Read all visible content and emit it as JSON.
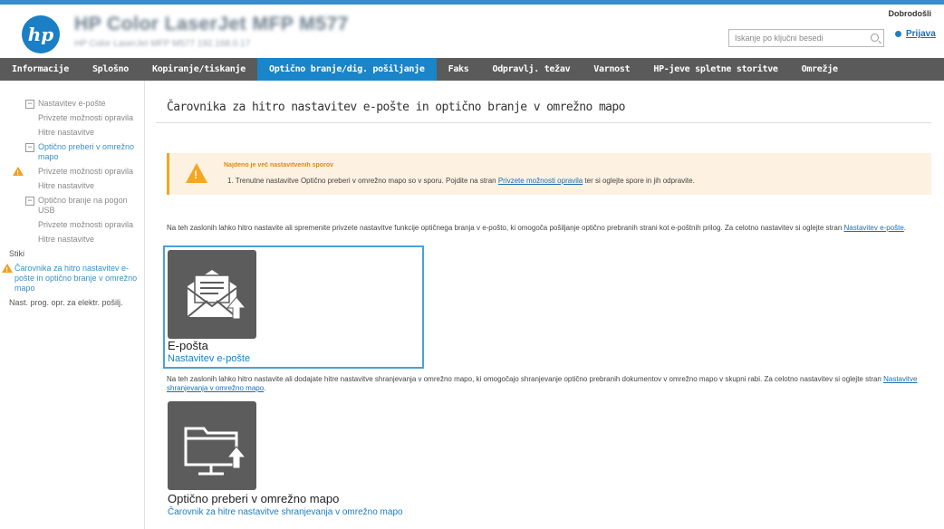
{
  "header": {
    "logo_text": "hp",
    "product_name": "HP Color LaserJet MFP M577",
    "product_sub": "HP Color LaserJet MFP M577   192.168.0.17",
    "welcome": "Dobrodošli",
    "search_placeholder": "Iskanje po ključni besedi",
    "signin": "Prijava"
  },
  "nav": {
    "tabs": [
      {
        "label": "Informacije",
        "active": false
      },
      {
        "label": "Splošno",
        "active": false
      },
      {
        "label": "Kopiranje/tiskanje",
        "active": false
      },
      {
        "label": "Optično branje/dig. pošiljanje",
        "active": true
      },
      {
        "label": "Faks",
        "active": false
      },
      {
        "label": "Odpravlj. težav",
        "active": false
      },
      {
        "label": "Varnost",
        "active": false
      },
      {
        "label": "HP-jeve spletne storitve",
        "active": false
      },
      {
        "label": "Omrežje",
        "active": false
      }
    ]
  },
  "sidebar": {
    "items": [
      {
        "label": "Nastavitev e-pošte",
        "kind": "group"
      },
      {
        "label": "Privzete možnosti opravila",
        "kind": "sub"
      },
      {
        "label": "Hitre nastavitve",
        "kind": "sub"
      },
      {
        "label": "Optično preberi v omrežno mapo",
        "kind": "group-link"
      },
      {
        "label": "Privzete možnosti opravila",
        "kind": "sub-warn"
      },
      {
        "label": "Hitre nastavitve",
        "kind": "sub"
      },
      {
        "label": "Optično branje na pogon USB",
        "kind": "group"
      },
      {
        "label": "Privzete možnosti opravila",
        "kind": "sub"
      },
      {
        "label": "Hitre nastavitve",
        "kind": "sub"
      },
      {
        "label": "Stiki",
        "kind": "plain"
      },
      {
        "label": "Čarovnika za hitro nastavitev e-pošte in optično branje v omrežno mapo",
        "kind": "plain-warn"
      },
      {
        "label": "Nast. prog. opr. za elektr. pošilj.",
        "kind": "plain"
      }
    ]
  },
  "main": {
    "title": "Čarovnika za hitro nastavitev e-pošte in optično branje v omrežno mapo",
    "warning": {
      "title": "Najdeno je več nastavitvenih sporov",
      "text_before": "1.  Trenutne nastavitve Optično preberi v omrežno mapo so v sporu. Pojdite na stran ",
      "link": "Privzete možnosti opravila",
      "text_after": " ter si oglejte spore in jih odpravite."
    },
    "desc_email_before": "Na teh zaslonih lahko hitro nastavite ali spremenite privzete nastavitve funkcije optičnega branja v e-pošto, ki omogoča pošiljanje optično prebranih strani kot e-poštnih prilog. Za celotno nastavitev si oglejte stran ",
    "desc_email_link": "Nastavitev e-pošte",
    "desc_email_after": ".",
    "email_card": {
      "title": "E-pošta",
      "link": "Nastavitev e-pošte"
    },
    "desc_folder_before": "Na teh zaslonih lahko hitro nastavite ali dodajate hitre nastavitve shranjevanja v omrežno mapo, ki omogočajo shranjevanje optično prebranih dokumentov v omrežno mapo v skupni rabi. Za celotno nastavitev si oglejte stran ",
    "desc_folder_link": "Nastavitve shranjevanja v omrežno mapo",
    "desc_folder_after": ".",
    "folder_card": {
      "title": "Optično preberi v omrežno mapo",
      "link": "Čarovnik za hitre nastavitve shranjevanja v omrežno mapo"
    }
  },
  "colors": {
    "accent": "#1a85c8",
    "nav_bg": "#5a5a5a",
    "warning": "#f5a623",
    "tile": "#5c5c5c"
  },
  "icons": [
    "hp-logo",
    "search-icon",
    "signin-icon",
    "warning-icon",
    "email-envelope-icon",
    "network-folder-icon",
    "collapse-toggle-icon"
  ]
}
